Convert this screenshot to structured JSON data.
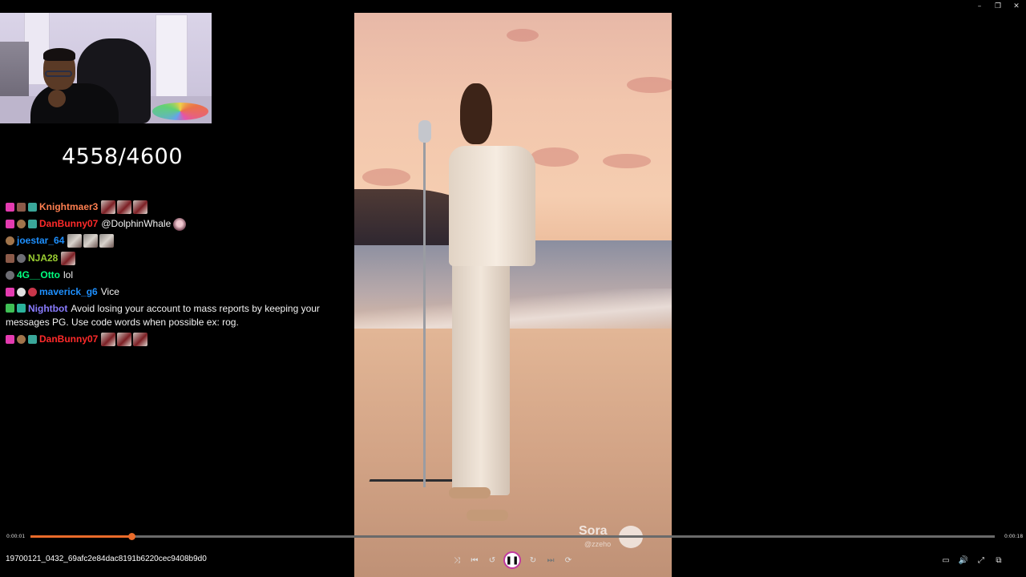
{
  "window": {
    "minimize_glyph": "–",
    "restore_glyph": "❐",
    "close_glyph": "✕"
  },
  "stream_goal": "4558/4600",
  "chat": [
    {
      "badges": [
        "heart",
        "crown",
        "gift"
      ],
      "username": "Knightmaer3",
      "color": "#ff7f50",
      "emotes": [
        "red",
        "red",
        "red"
      ],
      "message": ""
    },
    {
      "badges": [
        "heart",
        "bits",
        "gift"
      ],
      "username": "DanBunny07",
      "color": "#ff2a2a",
      "mention": "@DolphinWhale",
      "emotes_after": [
        "pink"
      ],
      "message": ""
    },
    {
      "badges": [
        "bits"
      ],
      "username": "joestar_64",
      "color": "#1e90ff",
      "emotes": [
        "gray",
        "gray",
        "gray"
      ],
      "message": ""
    },
    {
      "badges": [
        "crown",
        "gray"
      ],
      "username": "NJA28",
      "color": "#9acd32",
      "emotes": [
        "red"
      ],
      "message": ""
    },
    {
      "badges": [
        "gray"
      ],
      "username": "4G__Otto",
      "color": "#00ff7f",
      "message": "lol"
    },
    {
      "badges": [
        "heart",
        "mod",
        "red"
      ],
      "username": "maverick_g6",
      "color": "#1e90ff",
      "message": "Vice"
    },
    {
      "badges": [
        "green",
        "teal"
      ],
      "username": "Nightbot",
      "color": "#8a7cff",
      "message": "Avoid losing your account to mass reports by keeping your messages PG. Use code words when possible ex: rog."
    },
    {
      "badges": [
        "heart",
        "bits",
        "gift"
      ],
      "username": "DanBunny07",
      "color": "#ff2a2a",
      "emotes": [
        "red",
        "red",
        "red"
      ],
      "message": ""
    }
  ],
  "video": {
    "watermark": "Sora",
    "watermark_handle": "@zzeho"
  },
  "player": {
    "current_time": "0:00:01",
    "total_time": "0:00:18",
    "progress_fraction": 0.105,
    "filename": "19700121_0432_69afc2e84dac8191b6220cec9408b9d0",
    "controls": {
      "shuffle": "⤨",
      "previous": "⏮",
      "rewind": "↺",
      "play_pause": "❚❚",
      "forward": "↻",
      "next": "⏭",
      "repeat": "⟳",
      "miniplayer": "▭",
      "volume": "🔊",
      "fullscreen": "⤢",
      "more": "⧉"
    },
    "accent_color": "#ea6b2a"
  }
}
